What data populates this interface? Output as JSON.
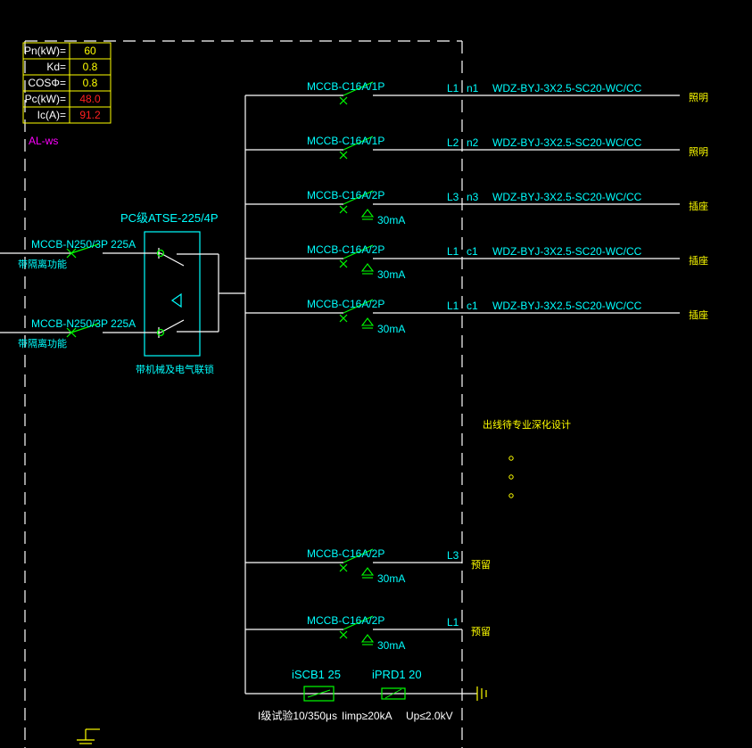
{
  "colors": {
    "background": "#000000",
    "line": "#ffffff",
    "breaker": "#00ff00",
    "label": "#00ffff",
    "table_border": "#ffff00",
    "warn_value": "#ff2020",
    "panel_tag": "#ff00ff",
    "note": "#ffff00",
    "ground": "#ffff00"
  },
  "load_table": {
    "rows": [
      {
        "label": "Pn(kW)=",
        "value": "60",
        "value_color": "#ffff00"
      },
      {
        "label": "Kd=",
        "value": "0.8",
        "value_color": "#ffff00"
      },
      {
        "label": "COSΦ=",
        "value": "0.8",
        "value_color": "#ffff00"
      },
      {
        "label": "Pc(kW)=",
        "value": "48.0",
        "value_color": "#ff2020"
      },
      {
        "label": "Ic(A)=",
        "value": "91.2",
        "value_color": "#ff2020"
      }
    ]
  },
  "panel_tag": "AL-ws",
  "ats": {
    "label": "PC级ATSE-225/4P",
    "note": "带机械及电气联锁"
  },
  "incomers": [
    {
      "breaker": "MCCB-N250/3P 225A",
      "note": "带隔离功能"
    },
    {
      "breaker": "MCCB-N250/3P 225A",
      "note": "带隔离功能"
    }
  ],
  "circuits": [
    {
      "breaker": "MCCB-C16A/1P",
      "rcd": "",
      "phase": "L1",
      "name": "n1",
      "cable": "WDZ-BYJ-3X2.5-SC20-WC/CC",
      "load": "照明"
    },
    {
      "breaker": "MCCB-C16A/1P",
      "rcd": "",
      "phase": "L2",
      "name": "n2",
      "cable": "WDZ-BYJ-3X2.5-SC20-WC/CC",
      "load": "照明"
    },
    {
      "breaker": "MCCB-C16A/2P",
      "rcd": "30mA",
      "phase": "L3",
      "name": "n3",
      "cable": "WDZ-BYJ-3X2.5-SC20-WC/CC",
      "load": "插座"
    },
    {
      "breaker": "MCCB-C16A/2P",
      "rcd": "30mA",
      "phase": "L1",
      "name": "c1",
      "cable": "WDZ-BYJ-3X2.5-SC20-WC/CC",
      "load": "插座"
    },
    {
      "breaker": "MCCB-C16A/2P",
      "rcd": "30mA",
      "phase": "L1",
      "name": "c1",
      "cable": "WDZ-BYJ-3X2.5-SC20-WC/CC",
      "load": "插座"
    },
    {
      "breaker": "MCCB-C16A/2P",
      "rcd": "30mA",
      "phase": "L3",
      "name": "",
      "cable": "",
      "load": "预留"
    },
    {
      "breaker": "MCCB-C16A/2P",
      "rcd": "30mA",
      "phase": "L1",
      "name": "",
      "cable": "",
      "load": "预留"
    }
  ],
  "design_note": "出线待专业深化设计",
  "spd": {
    "scb": "iSCB1 25",
    "prd": "iPRD1 20",
    "test_class": "I级试验10/350μs",
    "imp": "Iimp≥20kA",
    "up": "Up≤2.0kV"
  }
}
